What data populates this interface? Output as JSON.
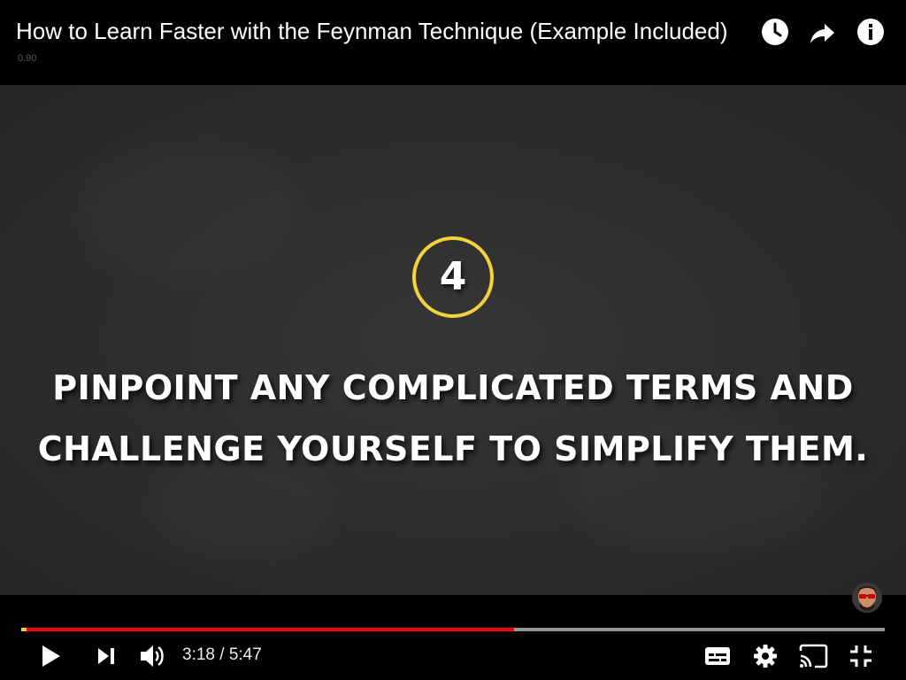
{
  "header": {
    "title": "How to Learn Faster with the Feynman Technique (Example Included)",
    "debug_label": "0.90",
    "icons": {
      "watch_later": "clock-icon",
      "share": "share-arrow-icon",
      "info": "info-icon"
    }
  },
  "video": {
    "step_number": "4",
    "headline_line1": "PINPOINT ANY COMPLICATED TERMS AND",
    "headline_line2": "CHALLENGE YOURSELF TO SIMPLIFY THEM.",
    "circle_color": "#f2d23e",
    "background_color": "#2e2e2e"
  },
  "controls": {
    "current_time": "3:18",
    "duration": "5:47",
    "time_display": "3:18 / 5:47",
    "progress_played_fraction": 0.571,
    "progress_loaded_fraction": 1.0,
    "played_color": "#ff0000",
    "icons": {
      "play": "play-icon",
      "next": "next-icon",
      "volume": "volume-icon",
      "subtitles": "subtitles-icon",
      "settings": "gear-icon",
      "cast": "cast-icon",
      "fullscreen_exit": "exit-fullscreen-icon"
    }
  }
}
